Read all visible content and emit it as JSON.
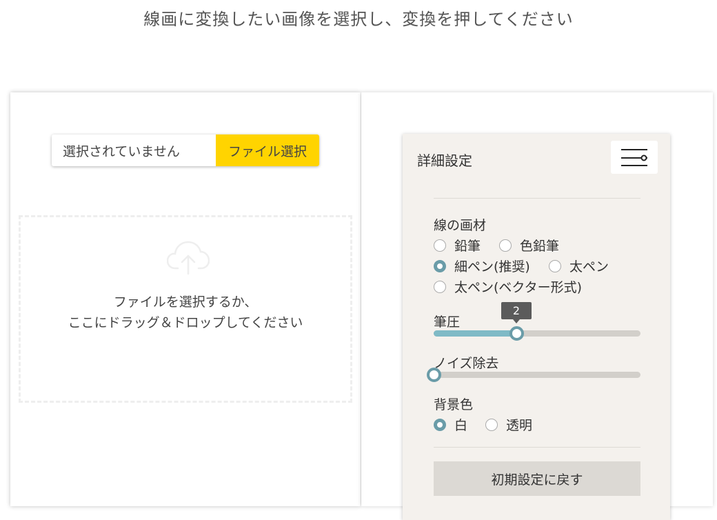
{
  "instruction": "線画に変換したい画像を選択し、変換を押してください",
  "upload": {
    "file_status": "選択されていません",
    "file_button": "ファイル選択",
    "drop_line1": "ファイルを選択するか、",
    "drop_line2": "ここにドラッグ＆ドロップしてください",
    "icon": "cloud-upload-icon"
  },
  "settings": {
    "title": "詳細設定",
    "menu_icon": "sliders-menu-icon",
    "line_material": {
      "label": "線の画材",
      "options": [
        {
          "label": "鉛筆",
          "checked": false
        },
        {
          "label": "色鉛筆",
          "checked": false
        },
        {
          "label": "細ペン(推奨)",
          "checked": true
        },
        {
          "label": "太ペン",
          "checked": false
        },
        {
          "label": "太ペン(ベクター形式)",
          "checked": false
        }
      ]
    },
    "pen_pressure": {
      "label": "筆圧",
      "value": "2",
      "fraction": 0.4
    },
    "noise_removal": {
      "label": "ノイズ除去",
      "fraction": 0.0
    },
    "background": {
      "label": "背景色",
      "options": [
        {
          "label": "白",
          "checked": true
        },
        {
          "label": "透明",
          "checked": false
        }
      ]
    },
    "reset_button": "初期設定に戻す"
  },
  "colors": {
    "accent_yellow": "#ffd400",
    "accent_teal": "#6a9ca8",
    "panel_beige": "#f4f1ed"
  }
}
